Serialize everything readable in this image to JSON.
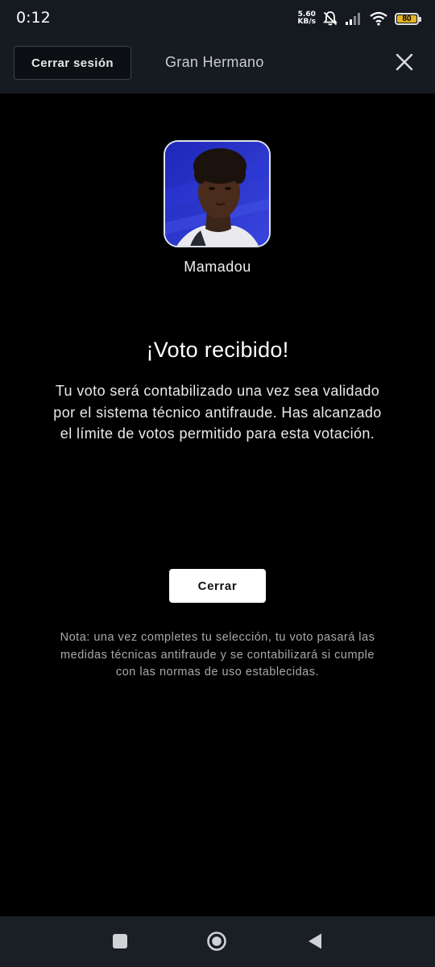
{
  "status_bar": {
    "time": "0:12",
    "net_speed_value": "5.60",
    "net_speed_unit": "KB/s",
    "battery_level": "80",
    "battery_color": "#e6b422"
  },
  "header": {
    "logout_label": "Cerrar sesión",
    "title": "Gran Hermano",
    "close_icon": "close-icon"
  },
  "candidate": {
    "name": "Mamadou",
    "photo": "candidate-photo"
  },
  "confirmation": {
    "title": "¡Voto recibido!",
    "message": "Tu voto será contabilizado una vez sea validado por el sistema técnico antifraude. Has alcanzado el límite de votos permitido para esta votación.",
    "close_button": "Cerrar",
    "note": "Nota: una vez completes tu selección, tu voto pasará las medidas técnicas antifraude y se contabilizará si cumple con las normas de uso establecidas."
  },
  "nav_bar": {
    "recents_icon": "square-icon",
    "home_icon": "circle-icon",
    "back_icon": "triangle-back-icon"
  }
}
